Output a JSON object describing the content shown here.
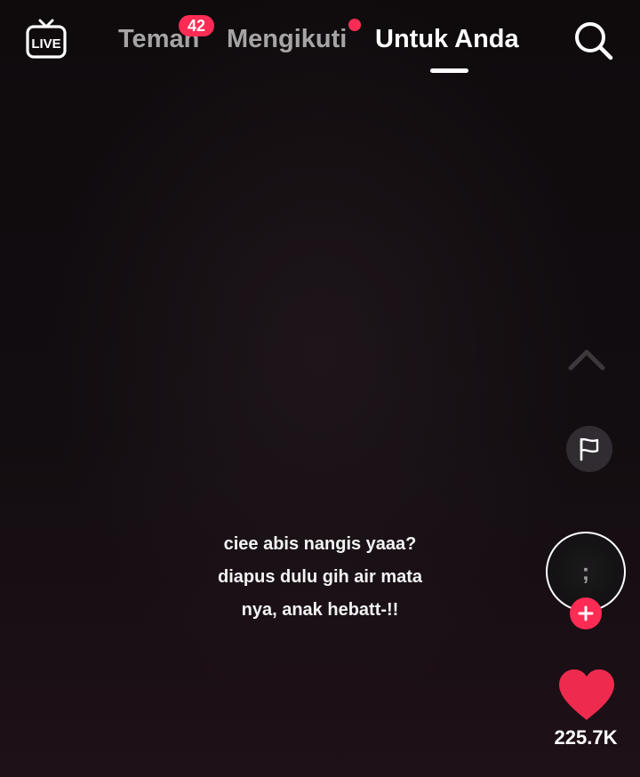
{
  "top_bar": {
    "live_label": "LIVE",
    "tabs": [
      {
        "label": "Teman",
        "active": false
      },
      {
        "label": "Mengikuti",
        "active": false
      },
      {
        "label": "Untuk Anda",
        "active": true
      }
    ],
    "teman_badge": "42",
    "mengikuti_has_dot": true
  },
  "video": {
    "caption_lines": [
      "ciee abis nangis yaaa?",
      "diapus dulu gih air mata",
      "nya, anak hebatt-!!"
    ]
  },
  "actions": {
    "avatar_glyph": ";",
    "like_count": "225.7K"
  },
  "colors": {
    "accent": "#fe2c55",
    "inactive_tab": "#a7a4a6",
    "active_tab": "#ffffff",
    "background": "#0d0a0c"
  },
  "icons": [
    "live-icon",
    "search-icon",
    "chevron-up-icon",
    "flag-icon",
    "plus-icon",
    "heart-icon"
  ]
}
